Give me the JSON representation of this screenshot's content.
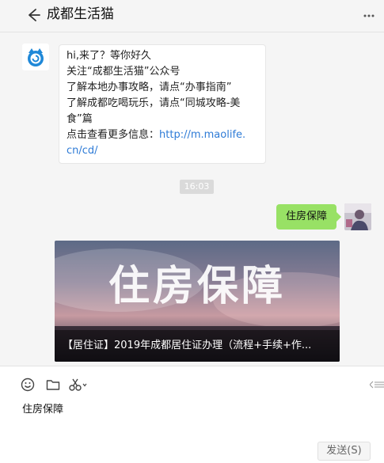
{
  "header": {
    "title": "成都生活猫",
    "back_icon": "arrow-left-icon",
    "more_icon": "more-vertical-icon"
  },
  "chat": {
    "received": {
      "avatar_icon": "cat-logo-icon",
      "lines": [
        "hi,来了？等你好久",
        "关注“成都生活猫”公众号",
        "了解本地办事攻略，请点“办事指南”",
        "了解成都吃喝玩乐，请点“同城攻略-美",
        "食”篇"
      ],
      "more_info_prefix": "点击查看更多信息：",
      "link_line1": "http://m.maolife.",
      "link_line2": "cn/cd/"
    },
    "timestamp": "16:03",
    "sent": {
      "text": "住房保障"
    },
    "news_card": {
      "hero_text": "住房保障",
      "caption": "【居住证】2019年成都居住证办理（流程+手续+作..."
    }
  },
  "input": {
    "text": "住房保障",
    "send_label": "发送(S)"
  },
  "colors": {
    "sent_bubble": "#98e165",
    "link": "#2e7bd6",
    "background": "#f5f5f5"
  }
}
